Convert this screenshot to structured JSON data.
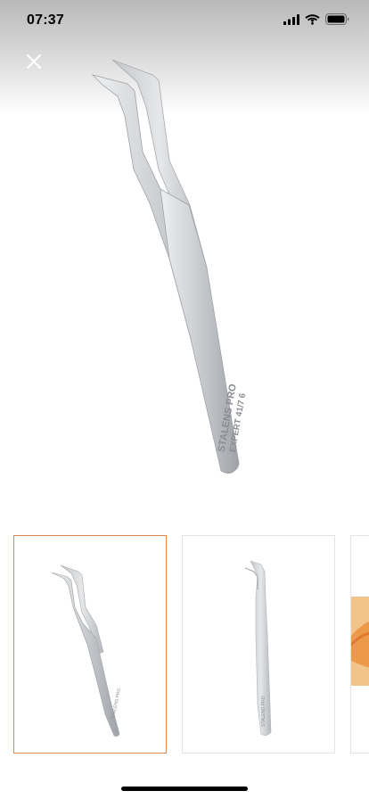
{
  "status_bar": {
    "time": "07:37",
    "icons": [
      "signal-icon",
      "wifi-icon",
      "battery-icon"
    ]
  },
  "viewer": {
    "close_icon": "close-icon",
    "engraving_brand": "STALENS PRO",
    "engraving_model": "EXPERT 41/7 6"
  },
  "thumbnails": [
    {
      "name": "thumb-tweezers-angled",
      "selected": true
    },
    {
      "name": "thumb-tweezers-straight",
      "selected": false
    },
    {
      "name": "thumb-tweezers-orange",
      "selected": false
    }
  ],
  "colors": {
    "selected_border": "#d9894e",
    "thumb_border": "#e4e4e4",
    "steel": "#c9cbce"
  }
}
